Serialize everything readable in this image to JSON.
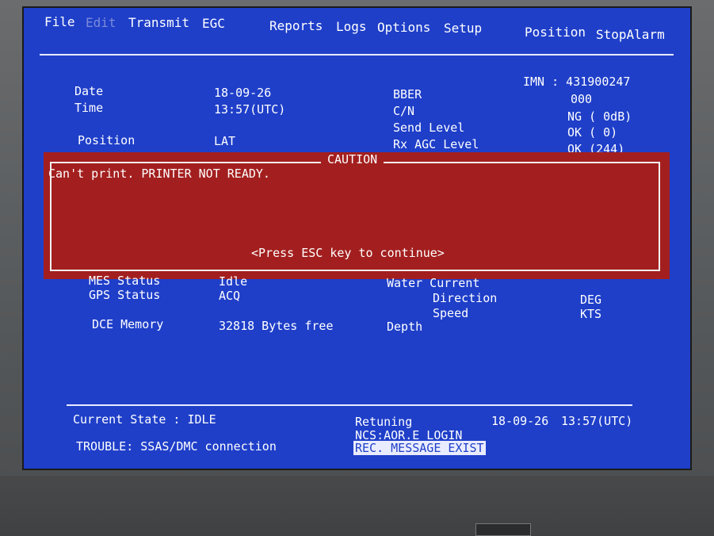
{
  "menu": {
    "file": "File",
    "edit": "Edit",
    "transmit": "Transmit",
    "egc": "EGC",
    "reports": "Reports",
    "logs": "Logs",
    "options": "Options",
    "setup": "Setup",
    "position": "Position",
    "stopalarm": "StopAlarm"
  },
  "info": {
    "imn": "IMN : 431900247",
    "date_label": "Date",
    "date_value": "18-09-26",
    "time_label": "Time",
    "time_value": "13:57(UTC)",
    "position_label": "Position",
    "position_value": "LAT",
    "bber_label": "BBER",
    "bber_value": "000",
    "cn_label": "C/N",
    "cn_value": "NG (  0dB)",
    "send_label": "Send Level",
    "send_value": "OK (  0)",
    "rxagc_label": "Rx AGC Level",
    "rxagc_value": "OK (244)"
  },
  "caution": {
    "title": "CAUTION",
    "message": "Can't print. PRINTER NOT READY.",
    "prompt": "<Press ESC key to continue>"
  },
  "status": {
    "mes_label": "MES Status",
    "mes_value": "Idle",
    "gps_label": "GPS Status",
    "gps_value": "ACQ",
    "dce_label": "DCE Memory",
    "dce_value": "32818 Bytes free",
    "water_label": "Water Current",
    "direction_label": "Direction",
    "direction_unit": "DEG",
    "speed_label": "Speed",
    "speed_unit": "KTS",
    "depth_label": "Depth"
  },
  "footer": {
    "current_state": "Current State : IDLE",
    "trouble": "TROUBLE: SSAS/DMC connection",
    "retuning": "Retuning",
    "ncs": "NCS:AOR.E  LOGIN",
    "rec_message": "REC. MESSAGE EXIST",
    "date": "18-09-26",
    "time": "13:57(UTC)"
  },
  "colors": {
    "screen_bg": "#1f3fc9",
    "caution_bg": "#a31f1f",
    "text": "#ffffff"
  }
}
